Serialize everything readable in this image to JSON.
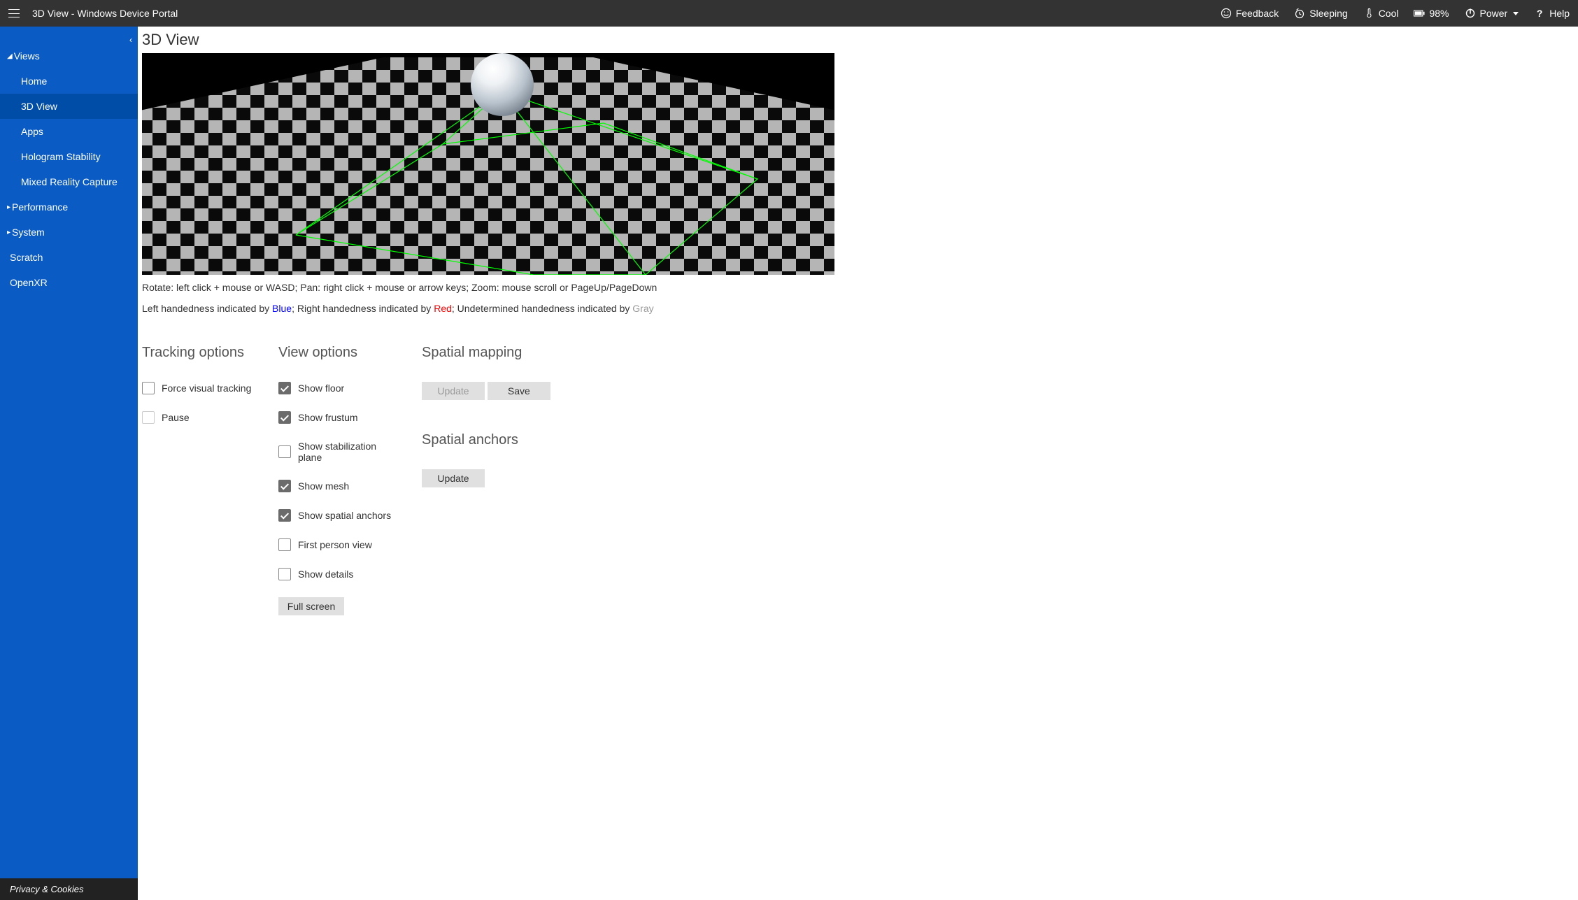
{
  "header": {
    "title": "3D View - Windows Device Portal",
    "feedback": "Feedback",
    "sleeping": "Sleeping",
    "cool": "Cool",
    "battery": "98%",
    "power": "Power",
    "help": "Help"
  },
  "sidebar": {
    "views_header": "Views",
    "views_items": [
      "Home",
      "3D View",
      "Apps",
      "Hologram Stability",
      "Mixed Reality Capture"
    ],
    "performance_header": "Performance",
    "system_header": "System",
    "scratch": "Scratch",
    "openxr": "OpenXR",
    "footer": "Privacy & Cookies"
  },
  "main": {
    "title": "3D View",
    "help": "Rotate: left click + mouse or WASD; Pan: right click + mouse or arrow keys; Zoom: mouse scroll or PageUp/PageDown",
    "hand_left_prefix": "Left handedness indicated by ",
    "hand_blue": "Blue",
    "hand_right_prefix": "; Right handedness indicated by ",
    "hand_red": "Red",
    "hand_undet_prefix": "; Undetermined handedness indicated by ",
    "hand_gray": "Gray"
  },
  "tracking": {
    "heading": "Tracking options",
    "force": "Force visual tracking",
    "pause": "Pause"
  },
  "view": {
    "heading": "View options",
    "floor": "Show floor",
    "frustum": "Show frustum",
    "stab": "Show stabilization plane",
    "mesh": "Show mesh",
    "anchors": "Show spatial anchors",
    "fpv": "First person view",
    "details": "Show details",
    "fullscreen": "Full screen"
  },
  "spatial_mapping": {
    "heading": "Spatial mapping",
    "update": "Update",
    "save": "Save"
  },
  "spatial_anchors": {
    "heading": "Spatial anchors",
    "update": "Update"
  }
}
